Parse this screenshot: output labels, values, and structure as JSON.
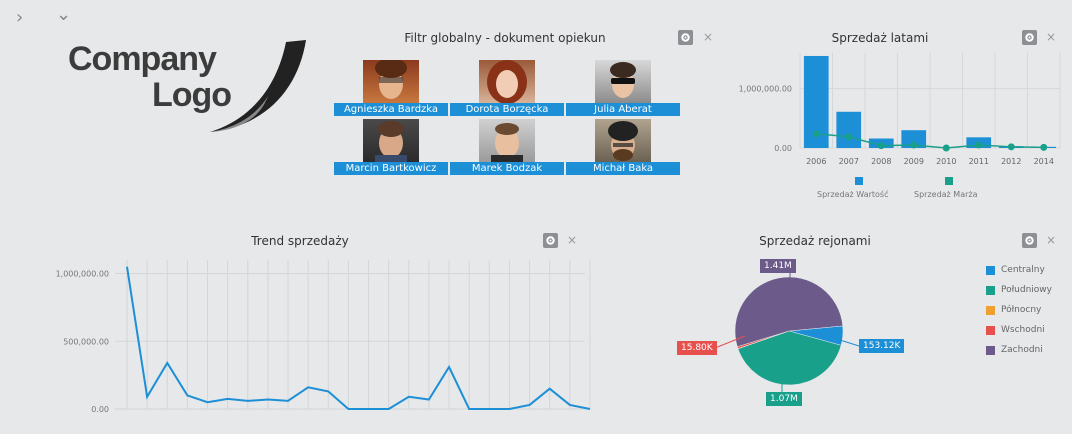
{
  "nav": {
    "expand_glyph": "›",
    "collapse_glyph": "⌄"
  },
  "logo": {
    "line1": "Company",
    "line2": "Logo"
  },
  "filter": {
    "title": "Filtr globalny - dokument opiekun",
    "people": [
      {
        "name": "Agnieszka Bardzka"
      },
      {
        "name": "Dorota Borzęcka"
      },
      {
        "name": "Julia Aberat"
      },
      {
        "name": "Marcin Bartkowicz"
      },
      {
        "name": "Marek Bodzak"
      },
      {
        "name": "Michał Baka"
      }
    ]
  },
  "panel_controls": {
    "close_glyph": "×"
  },
  "colors": {
    "blue": "#1d8fd6",
    "teal": "#19a08b",
    "orange": "#f0a030",
    "red": "#e8504e",
    "purple": "#6b5a8a"
  },
  "charts": {
    "years": {
      "title": "Sprzedaż latami",
      "legend": [
        "Sprzedaż Wartość",
        "Sprzedaż Marża"
      ]
    },
    "trend": {
      "title": "Trend sprzedaży"
    },
    "regions": {
      "title": "Sprzedaż rejonami",
      "labels": {
        "zachodni": "1.41M",
        "wschodni": "15.80K",
        "centralny": "153.12K",
        "poludniowy": "1.07M"
      },
      "legend": [
        "Centralny",
        "Południowy",
        "Północny",
        "Wschodni",
        "Zachodni"
      ]
    }
  },
  "chart_data": [
    {
      "type": "bar",
      "title": "Sprzedaż latami",
      "categories": [
        "2006",
        "2007",
        "2008",
        "2009",
        "2010",
        "2011",
        "2012",
        "2014"
      ],
      "y_ticks": [
        "1,000,000.00",
        "0.00"
      ],
      "ylim": [
        0,
        1600000
      ],
      "series": [
        {
          "name": "Sprzedaż Wartość",
          "type": "bar",
          "values": [
            1550000,
            610000,
            160000,
            300000,
            0,
            180000,
            30000,
            20000
          ]
        },
        {
          "name": "Sprzedaż Marża",
          "type": "line",
          "values": [
            240000,
            190000,
            40000,
            50000,
            0,
            50000,
            20000,
            10000
          ]
        }
      ],
      "legend_position": "bottom"
    },
    {
      "type": "line",
      "title": "Trend sprzedaży",
      "y_ticks": [
        "1,000,000.00",
        "500,000.00",
        "0.00"
      ],
      "ylim": [
        0,
        1100000
      ],
      "values": [
        1050000,
        90000,
        340000,
        100000,
        50000,
        75000,
        60000,
        70000,
        60000,
        160000,
        130000,
        0,
        0,
        0,
        90000,
        70000,
        310000,
        0,
        0,
        0,
        30000,
        150000,
        30000,
        0
      ],
      "grid": true
    },
    {
      "type": "pie",
      "title": "Sprzedaż rejonami",
      "slices": [
        {
          "name": "Centralny",
          "value": 153120
        },
        {
          "name": "Południowy",
          "value": 1070000
        },
        {
          "name": "Północny",
          "value": 2000
        },
        {
          "name": "Wschodni",
          "value": 15800
        },
        {
          "name": "Zachodni",
          "value": 1410000
        }
      ],
      "legend_position": "right"
    }
  ]
}
